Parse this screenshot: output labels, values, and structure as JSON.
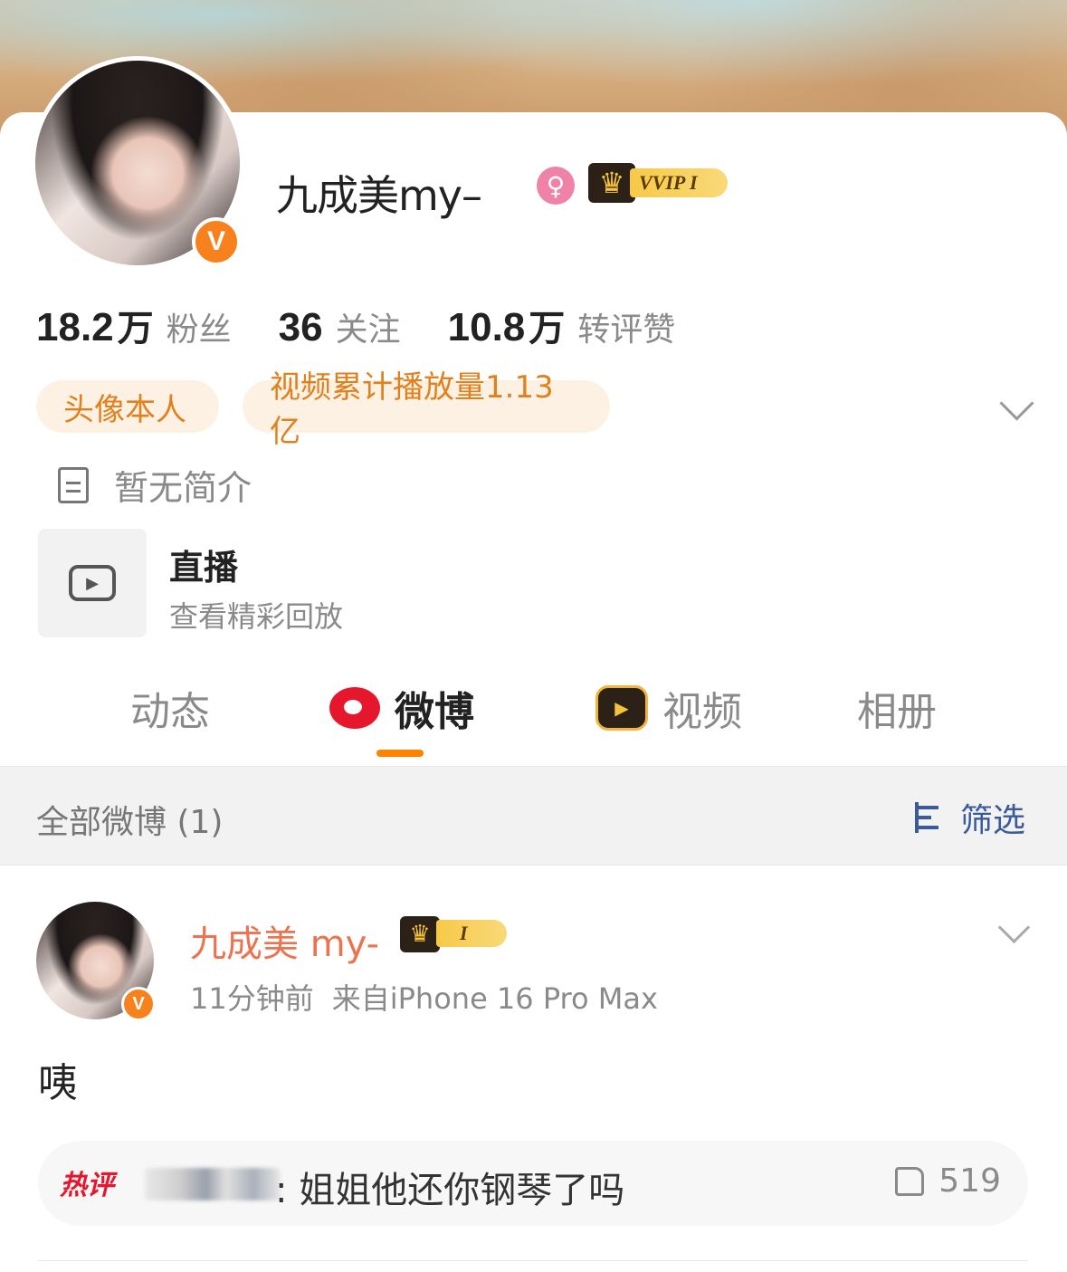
{
  "profile": {
    "username": "九成美my–",
    "vip_label": "VVIP I",
    "verified_badge": "V",
    "gender_icon": "female-icon",
    "crown_icon": "crown-icon"
  },
  "stats": [
    {
      "num": "18.2",
      "unit": "万",
      "label": "粉丝"
    },
    {
      "num": "36",
      "unit": "",
      "label": "关注"
    },
    {
      "num": "10.8",
      "unit": "万",
      "label": "转评赞"
    }
  ],
  "tags": [
    "头像本人",
    "视频累计播放量1.13亿"
  ],
  "bio": "暂无简介",
  "live": {
    "title": "直播",
    "subtitle": "查看精彩回放"
  },
  "tabs": [
    {
      "label": "动态",
      "active": false
    },
    {
      "label": "微博",
      "active": true
    },
    {
      "label": "视频",
      "active": false
    },
    {
      "label": "相册",
      "active": false
    }
  ],
  "filter": {
    "title": "全部微博 (1)",
    "button": "筛选"
  },
  "post": {
    "author": "九成美 my-",
    "vip_label": "I",
    "time": "11分钟前",
    "source": "来自iPhone 16 Pro Max",
    "text": "咦",
    "hot_comment": {
      "label": "热评",
      "text": ": 姐姐他还你钢琴了吗",
      "likes": "519"
    }
  },
  "colors": {
    "accent": "#ff8200",
    "tag_text": "#e0811e",
    "tag_bg": "#fdf1e4",
    "author_name": "#eb7350",
    "filter_blue": "#3a5b9a",
    "verified": "#f7811d"
  }
}
